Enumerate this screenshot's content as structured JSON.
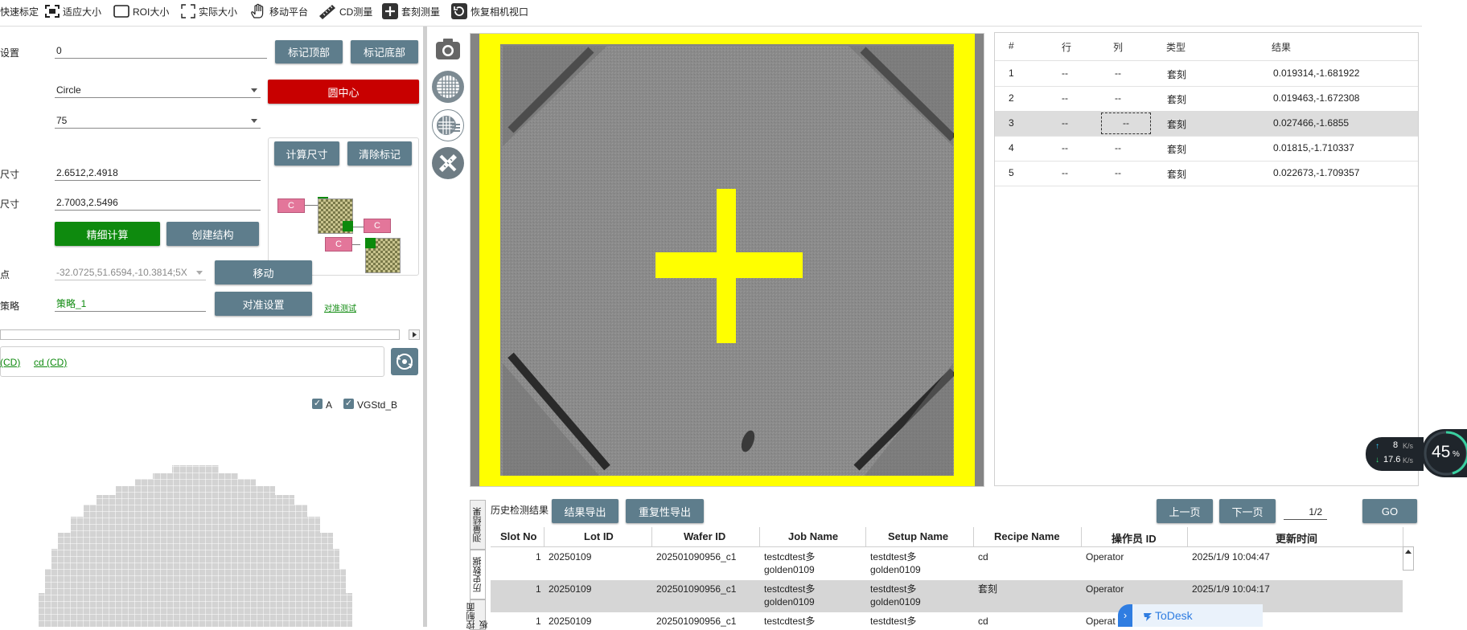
{
  "toolbar": {
    "items": [
      {
        "label": "快速标定",
        "icon": "calibrate-icon"
      },
      {
        "label": "适应大小",
        "icon": "fit-size-icon"
      },
      {
        "label": "ROI大小",
        "icon": "roi-icon"
      },
      {
        "label": "实际大小",
        "icon": "actual-size-icon"
      },
      {
        "label": "移动平台",
        "icon": "hand-icon"
      },
      {
        "label": "CD测量",
        "icon": "ruler-icon"
      },
      {
        "label": "套刻测量",
        "icon": "plus-icon"
      },
      {
        "label": "恢复相机视口",
        "icon": "camera-reset-icon"
      }
    ]
  },
  "left": {
    "settings_label": "设置",
    "settings_value": "0",
    "mark_top": "标记顶部",
    "mark_bottom": "标记底部",
    "shape_value": "Circle",
    "circle_center": "圆中心",
    "num_value": "75",
    "calc_size": "计算尺寸",
    "clear_mark": "清除标记",
    "size1_label": "尺寸",
    "size1_value": "2.6512,2.4918",
    "size2_label": "尺寸",
    "size2_value": "2.7003,2.5496",
    "fine_calc": "精细计算",
    "create_struct": "创建结构",
    "mini_c1": "C",
    "mini_c2": "C",
    "mini_c3": "C",
    "point_label": "点",
    "point_value": "-32.0725,51.6594,-10.3814;5X",
    "move": "移动",
    "strategy_label": "策略",
    "strategy_value": "策略_1",
    "align_setup": "对准设置",
    "align_test": "对准测试",
    "recipe_link1": "(CD)",
    "recipe_link2": "cd (CD)",
    "check_a": "A",
    "check_vg": "VGStd_B",
    "checkmark": "✓"
  },
  "results": {
    "headers": [
      "#",
      "行",
      "列",
      "类型",
      "结果"
    ],
    "rows": [
      [
        "1",
        "--",
        "--",
        "套刻",
        "0.019314,-1.681922"
      ],
      [
        "2",
        "--",
        "--",
        "套刻",
        "0.019463,-1.672308"
      ],
      [
        "3",
        "--",
        "--",
        "套刻",
        "0.027466,-1.6855"
      ],
      [
        "4",
        "--",
        "--",
        "套刻",
        "0.01815,-1.710337"
      ],
      [
        "5",
        "--",
        "--",
        "套刻",
        "0.022673,-1.709357"
      ]
    ]
  },
  "history": {
    "title": "历史检测结果",
    "export_results": "结果导出",
    "export_repeat": "重复性导出",
    "prev": "上一页",
    "next": "下一页",
    "page": "1/2",
    "go": "GO",
    "tabs": [
      "测量结果",
      "历史数据",
      "控制面板"
    ],
    "headers": [
      "Slot No",
      "Lot ID",
      "Wafer ID",
      "Job Name",
      "Setup Name",
      "Recipe Name",
      "操作员 ID",
      "更新时间"
    ],
    "rows": [
      {
        "slot": "1",
        "lot": "20250109",
        "wafer": "202501090956_c1",
        "job1": "testcdtest多",
        "job2": "golden0109",
        "setup1": "testdtest多",
        "setup2": "golden0109",
        "recipe": "cd",
        "op": "Operator",
        "time": "2025/1/9 10:04:47"
      },
      {
        "slot": "1",
        "lot": "20250109",
        "wafer": "202501090956_c1",
        "job1": "testcdtest多",
        "job2": "golden0109",
        "setup1": "testdtest多",
        "setup2": "golden0109",
        "recipe": "套刻",
        "op": "Operator",
        "time": "2025/1/9 10:04:17"
      },
      {
        "slot": "1",
        "lot": "20250109",
        "wafer": "202501090956_c1",
        "job1": "testcdtest多",
        "job2": "",
        "setup1": "testdtest多",
        "setup2": "",
        "recipe": "cd",
        "op": "Operat",
        "time": ""
      }
    ]
  },
  "overlay": {
    "upload": "8",
    "upload_unit": "K/s",
    "download": "17.6",
    "download_unit": "K/s",
    "percent": "45",
    "percent_sign": "%",
    "todesk": "ToDesk"
  },
  "colors": {
    "slate": "#5e7d8c",
    "red": "#c80000",
    "green": "#0e8a0e",
    "yellow": "#ffff00"
  }
}
